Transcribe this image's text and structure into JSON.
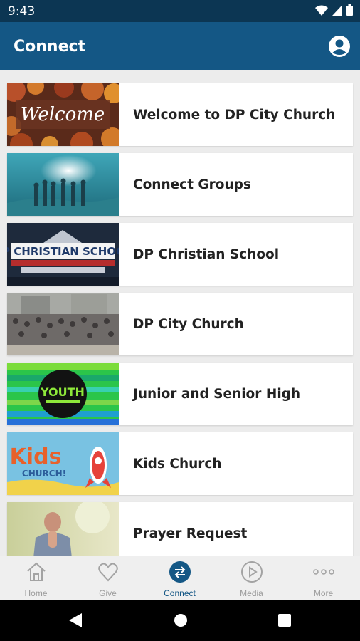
{
  "status_bar": {
    "time": "9:43"
  },
  "app_bar": {
    "title": "Connect"
  },
  "cards": [
    {
      "label": "Welcome to DP City Church",
      "thumb_text": "Welcome"
    },
    {
      "label": "Connect Groups"
    },
    {
      "label": "DP Christian School",
      "thumb_text": "DP CHRISTIAN SCHOOL"
    },
    {
      "label": "DP City Church"
    },
    {
      "label": "Junior and Senior High",
      "thumb_text": "YOUTH"
    },
    {
      "label": "Kids Church",
      "thumb_text": "Kids",
      "thumb_text_2": "CHURCH!"
    },
    {
      "label": "Prayer Request"
    }
  ],
  "bottom_nav": {
    "items": [
      {
        "label": "Home",
        "icon": "home-icon"
      },
      {
        "label": "Give",
        "icon": "heart-icon"
      },
      {
        "label": "Connect",
        "icon": "connect-icon",
        "active": true
      },
      {
        "label": "Media",
        "icon": "play-icon"
      },
      {
        "label": "More",
        "icon": "more-icon"
      }
    ]
  },
  "colors": {
    "app_bar": "#145785",
    "status_bar": "#0c3653",
    "active": "#145785",
    "inactive": "#9a9a9a"
  }
}
